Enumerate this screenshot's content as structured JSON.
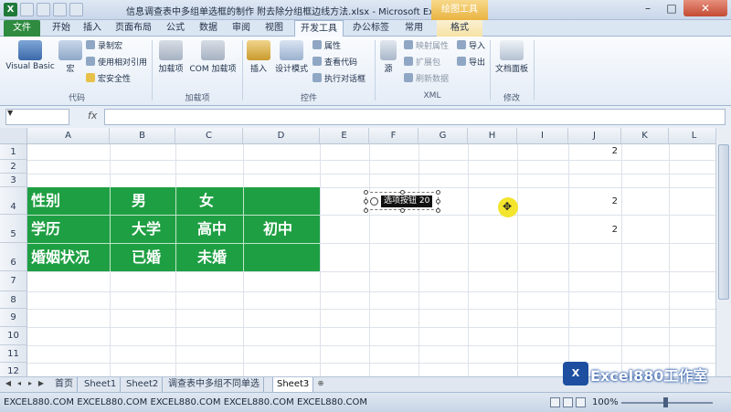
{
  "window": {
    "title": "信息调查表中多组单选框的制作 附去除分组框边线方法.xlsx - Microsoft Ex...",
    "context_tab_header": "绘图工具",
    "app_icon": "excel-icon",
    "close_glyph": "✕",
    "min_glyph": "–",
    "max_glyph": "□"
  },
  "ribbon": {
    "tabs": [
      "文件",
      "开始",
      "插入",
      "页面布局",
      "公式",
      "数据",
      "审阅",
      "视图",
      "开发工具",
      "办公标签",
      "常用",
      "格式"
    ],
    "active_tab": "开发工具",
    "groups": {
      "code": {
        "label": "代码",
        "visual_basic": "Visual Basic",
        "macro": "宏",
        "record_macro": "录制宏",
        "relative_ref": "使用相对引用",
        "macro_security": "宏安全性"
      },
      "addins": {
        "label": "加载项",
        "addins": "加载项",
        "com_addins": "COM 加载项"
      },
      "controls": {
        "label": "控件",
        "insert": "插入",
        "design_mode": "设计模式",
        "properties": "属性",
        "view_code": "查看代码",
        "run_dialog": "执行对话框"
      },
      "xml": {
        "label": "XML",
        "source": "源",
        "map_properties": "映射属性",
        "expansion_pack": "扩展包",
        "refresh_data": "刷新数据",
        "import": "导入",
        "export": "导出"
      },
      "modify": {
        "label": "修改",
        "document_panel": "文档面板"
      }
    }
  },
  "formula_bar": {
    "fx": "fx",
    "name_box_value": "",
    "formula_value": ""
  },
  "grid": {
    "columns": [
      "A",
      "B",
      "C",
      "D",
      "E",
      "F",
      "G",
      "H",
      "I",
      "J",
      "K",
      "L"
    ],
    "rows": [
      "1",
      "2",
      "3",
      "4",
      "5",
      "6",
      "7",
      "8",
      "9",
      "10",
      "11",
      "12"
    ],
    "table": [
      [
        "性别",
        "男",
        "女",
        ""
      ],
      [
        "学历",
        "大学",
        "高中",
        "初中"
      ],
      [
        "婚姻状况",
        "已婚",
        "未婚",
        ""
      ]
    ],
    "j_values": {
      "row1": "2",
      "row4": "2",
      "row5": "2"
    },
    "table_color": "#1f9f43"
  },
  "option_button": {
    "label": "选项按钮 20"
  },
  "sheet_tabs": [
    "首页",
    "Sheet1",
    "Sheet2",
    "调查表中多组不同单选",
    "Sheet3"
  ],
  "active_sheet": "Sheet3",
  "brand": {
    "logo_text": "X",
    "text": "Excel880工作室"
  },
  "status": {
    "text": "EXCEL880.COM EXCEL880.COM EXCEL880.COM EXCEL880.COM EXCEL880.COM",
    "zoom": "100%"
  }
}
